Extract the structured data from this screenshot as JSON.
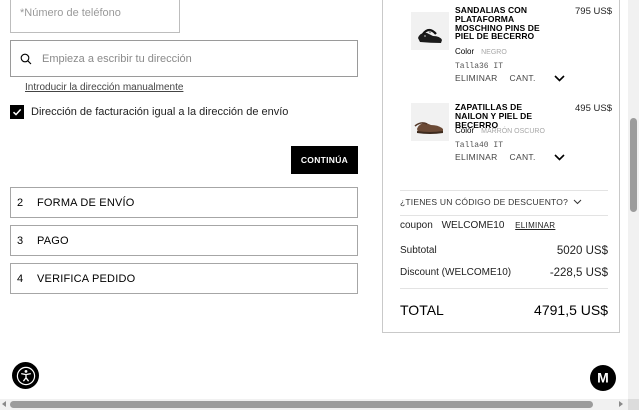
{
  "shipping_form": {
    "phone_placeholder": "*Número de teléfono",
    "address_placeholder": "Empieza a escribir tu dirección",
    "manual_address_link": "Introducir la dirección manualmente",
    "billing_same_label": "Dirección de facturación igual a la dirección de envío",
    "billing_same_checked": true,
    "continue_button": "CONTINÚA"
  },
  "steps": [
    {
      "number": "2",
      "label": "FORMA DE ENVÍO"
    },
    {
      "number": "3",
      "label": "PAGO"
    },
    {
      "number": "4",
      "label": "VERIFICA PEDIDO"
    }
  ],
  "cart": {
    "items": [
      {
        "name": "SANDALIAS CON PLATAFORMA MOSCHINO PINS DE PIEL DE BECERRO",
        "price": "795 US$",
        "color_label": "Color",
        "color_value": "NEGRO",
        "size": "Talla36 IT",
        "remove_label": "ELIMINAR",
        "qty_label": "CANT."
      },
      {
        "name": "ZAPATILLAS DE NAILON Y PIEL DE BECERRO",
        "price": "495 US$",
        "color_label": "Color",
        "color_value": "MARRÓN OSCURO",
        "size": "Talla40 IT",
        "remove_label": "ELIMINAR",
        "qty_label": "CANT."
      }
    ],
    "discount_toggle": "¿TIENES UN CÓDIGO DE DESCUENTO?",
    "coupon_label": "coupon",
    "coupon_code": "WELCOME10",
    "coupon_remove": "ELIMINAR",
    "subtotal_label": "Subtotal",
    "subtotal_value": "5020 US$",
    "discount_label": "Discount (WELCOME10)",
    "discount_value": "-228,5 US$",
    "total_label": "TOTAL",
    "total_value": "4791,5 US$"
  },
  "widgets": {
    "chat_logo": "M"
  },
  "colors": {
    "primary": "#000000",
    "border": "#a6a6a6",
    "muted_text": "#a7a7a7"
  }
}
